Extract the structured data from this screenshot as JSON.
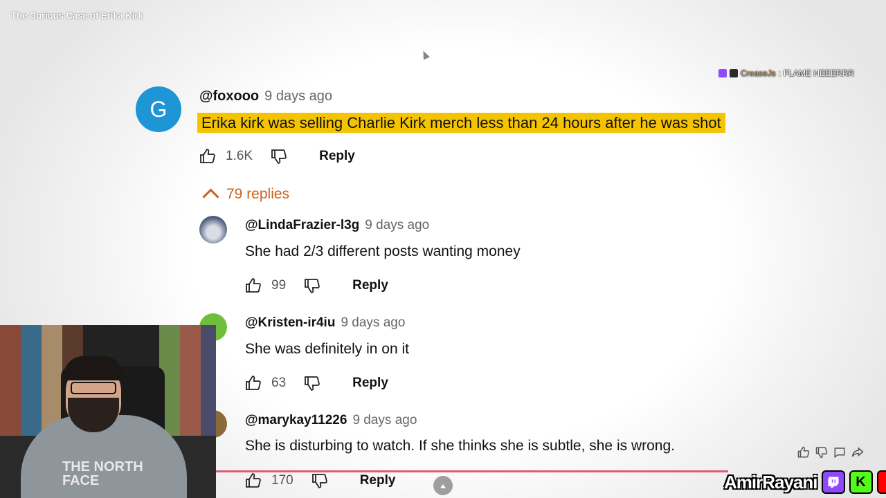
{
  "video": {
    "title": "The Curious Case of Erika Kirk"
  },
  "chat_overlay": {
    "username": "CreaseJs",
    "separator": ":",
    "message": "FLAME HEEERRR"
  },
  "main_comment": {
    "avatar_letter": "G",
    "author": "@foxooo",
    "time": "9 days ago",
    "text": "Erika kirk was selling Charlie Kirk merch less than 24 hours after he was shot",
    "likes": "1.6K",
    "reply_label": "Reply",
    "replies_count": "79 replies",
    "colors": {
      "avatar": "#1e96d6",
      "highlight": "#f5c400",
      "replies_toggle": "#c9611a"
    }
  },
  "replies": [
    {
      "author": "@LindaFrazier-l3g",
      "time": "9 days ago",
      "text": "She had 2/3 different posts wanting money",
      "likes": "99",
      "reply_label": "Reply"
    },
    {
      "author": "@Kristen-ir4iu",
      "time": "9 days ago",
      "text": "She was definitely in on it",
      "likes": "63",
      "reply_label": "Reply"
    },
    {
      "author": "@marykay11226",
      "time": "9 days ago",
      "text": "She is disturbing to watch. If she thinks she is subtle, she is wrong.",
      "likes": "170",
      "reply_label": "Reply"
    }
  ],
  "webcam": {
    "hoodie_text": "THE NORTH FACE"
  },
  "player_controls": {
    "icons": [
      "thumbs-up-icon",
      "thumbs-down-icon",
      "comment-icon",
      "share-icon"
    ]
  },
  "branding": {
    "name": "AmirRayani",
    "icons": [
      "twitch-icon",
      "kick-icon",
      "youtube-icon"
    ],
    "kick_letter": "K"
  }
}
